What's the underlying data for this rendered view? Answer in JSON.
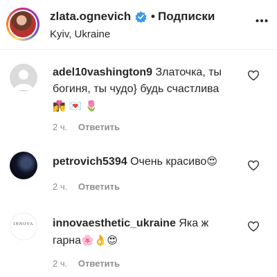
{
  "header": {
    "username": "zlata.ognevich",
    "separator": "•",
    "follow_label": "Подписки",
    "location": "Kyiv, Ukraine",
    "verified_color": "#3897f0"
  },
  "comments": [
    {
      "username": "adel10vashington9",
      "text": "Златочка, ты богиня, ты чудо} будь счастлива",
      "emojis": "👩‍❤️‍💋‍👨 💌 🌷",
      "time": "2 ч.",
      "reply_label": "Ответить",
      "avatar": "default-avatar"
    },
    {
      "username": "petrovich5394",
      "text": "Очень красиво",
      "emojis": "😍",
      "time": "2 ч.",
      "reply_label": "Ответить",
      "avatar": "photo-avatar"
    },
    {
      "username": "innovaesthetic_ukraine",
      "text": "Яка ж гарна",
      "emojis": "🌸👌😍",
      "time": "2 ч.",
      "reply_label": "Ответить",
      "avatar_text": "INNOVA",
      "avatar": "logo-avatar"
    }
  ]
}
